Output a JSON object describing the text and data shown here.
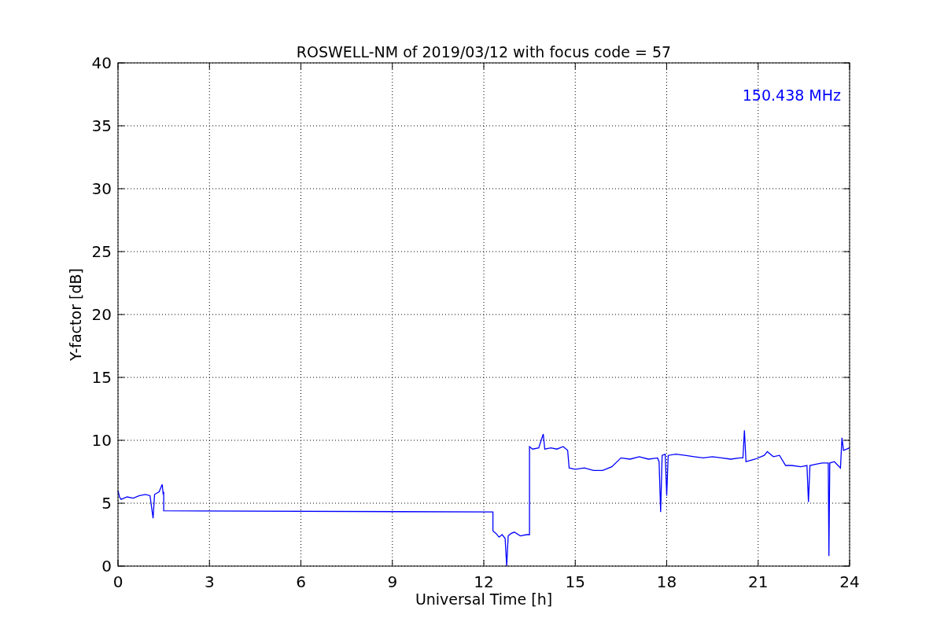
{
  "figure": {
    "chart_data": {
      "type": "line",
      "title": "ROSWELL-NM of 2019/03/12 with focus code = 57",
      "xlabel": "Universal Time [h]",
      "ylabel": "Y-factor [dB]",
      "x": [
        0,
        0.05,
        0.1,
        0.3,
        0.5,
        0.7,
        0.9,
        1.05,
        1.15,
        1.2,
        1.35,
        1.45,
        1.48,
        1.5,
        1.5,
        12.3,
        12.3,
        12.4,
        12.5,
        12.6,
        12.7,
        12.75,
        12.8,
        12.9,
        13.0,
        13.2,
        13.4,
        13.5,
        13.5,
        13.6,
        13.8,
        13.95,
        14.0,
        14.2,
        14.4,
        14.6,
        14.75,
        14.8,
        15.0,
        15.3,
        15.6,
        15.9,
        16.2,
        16.5,
        16.8,
        17.1,
        17.4,
        17.7,
        17.75,
        17.8,
        17.85,
        17.95,
        18.0,
        18.05,
        18.3,
        18.6,
        18.9,
        19.2,
        19.5,
        19.8,
        20.1,
        20.4,
        20.5,
        20.55,
        20.6,
        20.9,
        21.2,
        21.3,
        21.5,
        21.7,
        21.9,
        22.1,
        22.4,
        22.6,
        22.65,
        22.7,
        22.9,
        23.1,
        23.3,
        23.32,
        23.35,
        23.5,
        23.7,
        23.75,
        23.8,
        24.0
      ],
      "series": [
        {
          "name": "150.438 MHz",
          "color": "#0000ff",
          "values": [
            6.0,
            5.5,
            5.3,
            5.5,
            5.4,
            5.6,
            5.7,
            5.6,
            3.8,
            5.7,
            5.9,
            6.5,
            5.8,
            5.9,
            4.4,
            4.3,
            2.8,
            2.6,
            2.3,
            2.5,
            2.2,
            0,
            2.4,
            2.6,
            2.7,
            2.4,
            2.5,
            2.5,
            9.5,
            9.3,
            9.4,
            10.5,
            9.3,
            9.4,
            9.3,
            9.5,
            9.2,
            7.8,
            7.7,
            7.8,
            7.6,
            7.6,
            7.9,
            8.6,
            8.5,
            8.7,
            8.5,
            8.6,
            8.3,
            4.3,
            8.8,
            8.9,
            5.6,
            8.8,
            8.9,
            8.8,
            8.7,
            8.6,
            8.7,
            8.6,
            8.5,
            8.6,
            8.6,
            10.8,
            8.3,
            8.5,
            8.8,
            9.1,
            8.7,
            8.8,
            8.0,
            8.0,
            7.9,
            8.0,
            5.1,
            8.0,
            8.1,
            8.2,
            8.2,
            0.8,
            8.2,
            8.3,
            7.8,
            10.2,
            9.2,
            9.4
          ]
        }
      ],
      "xlim": [
        0,
        24
      ],
      "ylim": [
        0,
        40
      ],
      "xticks": [
        0,
        3,
        6,
        9,
        12,
        15,
        18,
        21,
        24
      ],
      "yticks": [
        0,
        5,
        10,
        15,
        20,
        25,
        30,
        35,
        40
      ],
      "grid": true
    }
  }
}
